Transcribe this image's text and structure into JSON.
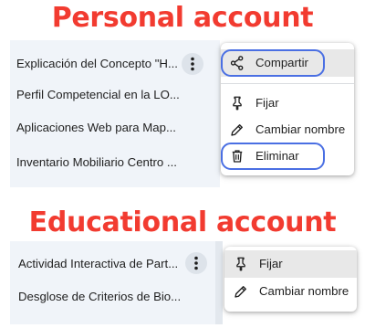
{
  "colors": {
    "heading": "#f23b30",
    "highlight_ring": "#4a6fe3",
    "list_bg": "#f0f4f9"
  },
  "personal": {
    "heading": "Personal account",
    "chats": [
      "Explicación del Concepto \"H...",
      "Perfil Competencial en la LO...",
      "Aplicaciones Web para Map...",
      "Inventario Mobiliario Centro ..."
    ],
    "menu": [
      {
        "icon": "share-icon",
        "label": "Compartir"
      },
      {
        "icon": "pin-icon",
        "label": "Fijar"
      },
      {
        "icon": "pencil-icon",
        "label": "Cambiar nombre"
      },
      {
        "icon": "trash-icon",
        "label": "Eliminar"
      }
    ]
  },
  "educational": {
    "heading": "Educational account",
    "chats": [
      "Actividad Interactiva de Part...",
      "Desglose de Criterios de Bio..."
    ],
    "menu": [
      {
        "icon": "pin-icon",
        "label": "Fijar"
      },
      {
        "icon": "pencil-icon",
        "label": "Cambiar nombre"
      }
    ]
  }
}
